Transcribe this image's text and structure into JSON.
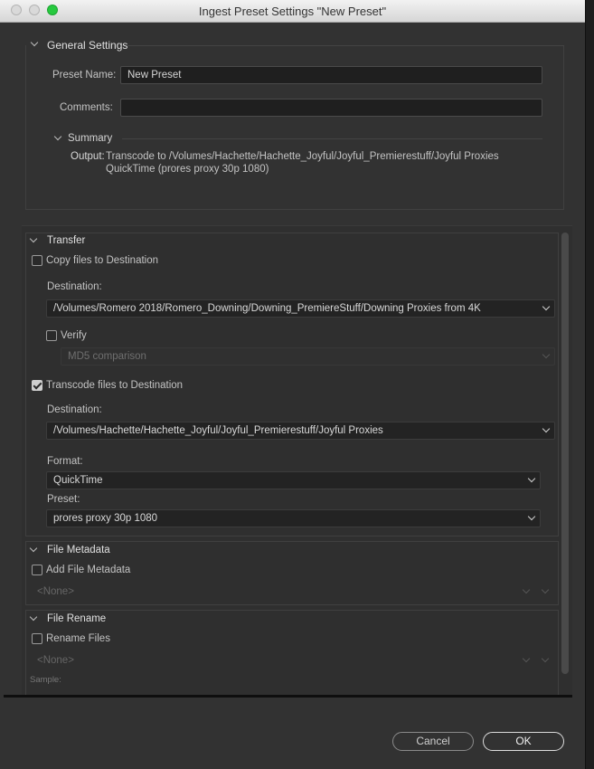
{
  "window": {
    "title": "Ingest Preset Settings \"New Preset\""
  },
  "general": {
    "heading": "General Settings",
    "preset_name_label": "Preset Name:",
    "preset_name_value": "New Preset",
    "comments_label": "Comments:",
    "comments_value": "",
    "summary_heading": "Summary",
    "output_label": "Output:",
    "output_line1": "Transcode to /Volumes/Hachette/Hachette_Joyful/Joyful_Premierestuff/Joyful Proxies",
    "output_line2": "QuickTime (prores proxy 30p 1080)"
  },
  "transfer": {
    "heading": "Transfer",
    "copy_label": "Copy files to Destination",
    "copy_checked": false,
    "copy_destination_label": "Destination:",
    "copy_destination_value": "/Volumes/Romero 2018/Romero_Downing/Downing_PremiereStuff/Downing Proxies from 4K",
    "verify_label": "Verify",
    "verify_checked": false,
    "verify_method": "MD5 comparison",
    "transcode_label": "Transcode files to Destination",
    "transcode_checked": true,
    "transcode_destination_label": "Destination:",
    "transcode_destination_value": "/Volumes/Hachette/Hachette_Joyful/Joyful_Premierestuff/Joyful Proxies",
    "format_label": "Format:",
    "format_value": "QuickTime",
    "preset_label": "Preset:",
    "preset_value": "prores proxy 30p 1080"
  },
  "file_metadata": {
    "heading": "File Metadata",
    "add_label": "Add File Metadata",
    "add_checked": false,
    "template_value": "<None>"
  },
  "file_rename": {
    "heading": "File Rename",
    "rename_label": "Rename Files",
    "rename_checked": false,
    "template_value": "<None>",
    "sample_label": "Sample:"
  },
  "buttons": {
    "cancel": "Cancel",
    "ok": "OK"
  },
  "colors": {
    "window_bg": "#323232",
    "field_bg": "#1f1f1f",
    "maximize_green": "#27c93f"
  }
}
